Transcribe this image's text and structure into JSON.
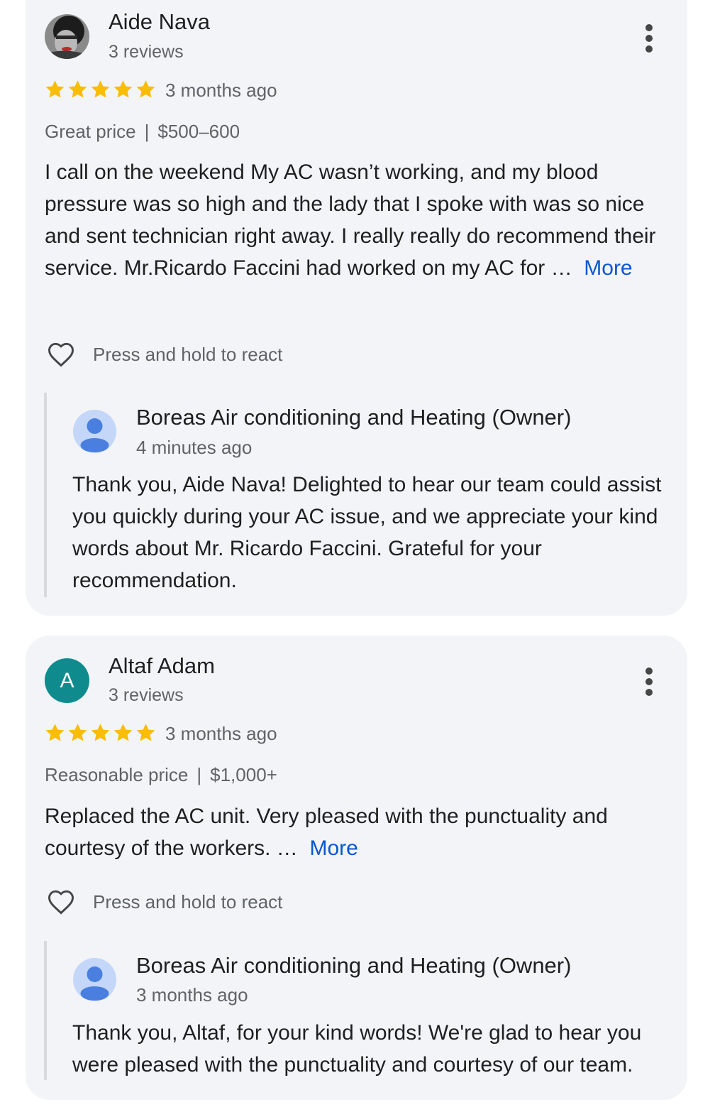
{
  "reviews": [
    {
      "reviewer_name": "Aide Nava",
      "reviewer_meta": "3 reviews",
      "avatar_type": "photo",
      "rating": 5,
      "date": "3 months ago",
      "price_label": "Great price",
      "price_range": "$500–600",
      "text": "I call on the weekend My AC wasn’t working, and my blood pressure was so high and the lady that I spoke with was so nice and sent technician right away. I really really do recommend their service. Mr.Ricardo Faccini had worked on my AC for …",
      "more_label": "More",
      "react_label": "Press and hold to react",
      "owner_reply": {
        "name": "Boreas Air conditioning and Heating (Owner)",
        "date": "4 minutes ago",
        "text": "Thank you, Aide Nava! Delighted to hear our team could assist you quickly during your AC issue, and we appreciate your kind words about Mr. Ricardo Faccini. Grateful for your recommendation."
      }
    },
    {
      "reviewer_name": "Altaf Adam",
      "reviewer_meta": "3 reviews",
      "avatar_type": "letter",
      "avatar_letter": "A",
      "avatar_color": "#0f8b8d",
      "rating": 5,
      "date": "3 months ago",
      "price_label": "Reasonable price",
      "price_range": "$1,000+",
      "text": "Replaced the AC unit. Very pleased with the punctuality and courtesy of the workers. …",
      "more_label": "More",
      "react_label": "Press and hold to react",
      "owner_reply": {
        "name": "Boreas Air conditioning and Heating (Owner)",
        "date": "3 months ago",
        "text": "Thank you, Altaf, for your kind words! We're glad to hear you were pleased with the punctuality and courtesy of our team."
      }
    }
  ],
  "colors": {
    "card_bg": "#f2f4f8",
    "star": "#fbbc04",
    "link": "#0b57d0",
    "owner_avatar_bg": "#c4d7f8",
    "owner_avatar_fg": "#4a7fe0"
  },
  "icons": [
    "star-icon",
    "heart-outline-icon",
    "more-vert-icon",
    "person-icon"
  ]
}
